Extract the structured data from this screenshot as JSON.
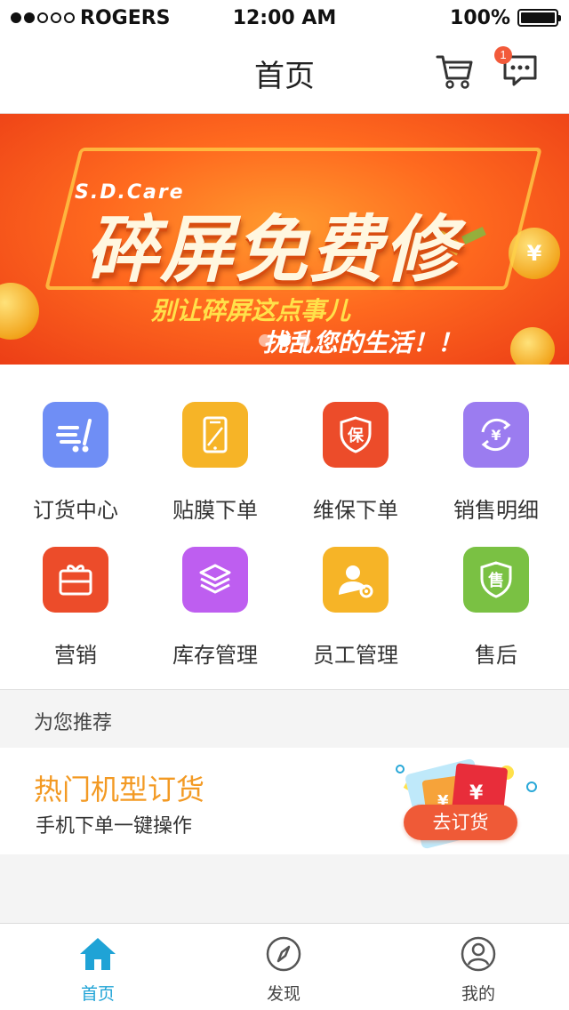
{
  "status_bar": {
    "carrier": "ROGERS",
    "time": "12:00 AM",
    "battery": "100%",
    "signal_strength": 2,
    "battery_level": 1.0
  },
  "nav": {
    "title": "首页",
    "cart_icon": "cart-icon",
    "message_icon": "message-icon",
    "message_badge": "1"
  },
  "banner": {
    "brand": "S.D.Care",
    "headline": "碎屏免费修",
    "line2": "别让碎屏这点事儿",
    "line3": "扰乱您的生活！！",
    "page_count": 3,
    "active_page": 1
  },
  "grid": {
    "items": [
      {
        "label": "订货中心",
        "icon": "order-cart-icon",
        "color": "#6f8ef5"
      },
      {
        "label": "贴膜下单",
        "icon": "phone-film-icon",
        "color": "#f6b427"
      },
      {
        "label": "维保下单",
        "icon": "warranty-shield-icon",
        "color": "#ec4c2a"
      },
      {
        "label": "销售明细",
        "icon": "yuan-cycle-icon",
        "color": "#9b7cf0"
      },
      {
        "label": "营销",
        "icon": "gift-box-icon",
        "color": "#ec4c2a"
      },
      {
        "label": "库存管理",
        "icon": "layers-icon",
        "color": "#be5ef0"
      },
      {
        "label": "员工管理",
        "icon": "staff-gear-icon",
        "color": "#f6b427"
      },
      {
        "label": "售后",
        "icon": "after-sale-shield-icon",
        "color": "#7ac143"
      }
    ]
  },
  "recommend": {
    "header": "为您推荐",
    "title": "热门机型订货",
    "subtitle": "手机下单一键操作",
    "button": "去订货"
  },
  "tab_bar": {
    "tabs": [
      {
        "label": "首页",
        "icon": "home-icon",
        "active": true
      },
      {
        "label": "发现",
        "icon": "compass-icon",
        "active": false
      },
      {
        "label": "我的",
        "icon": "profile-icon",
        "active": false
      }
    ]
  },
  "colors": {
    "accent_blue": "#1fa3d6",
    "accent_orange": "#f39a24",
    "button_red": "#ef5a37"
  }
}
